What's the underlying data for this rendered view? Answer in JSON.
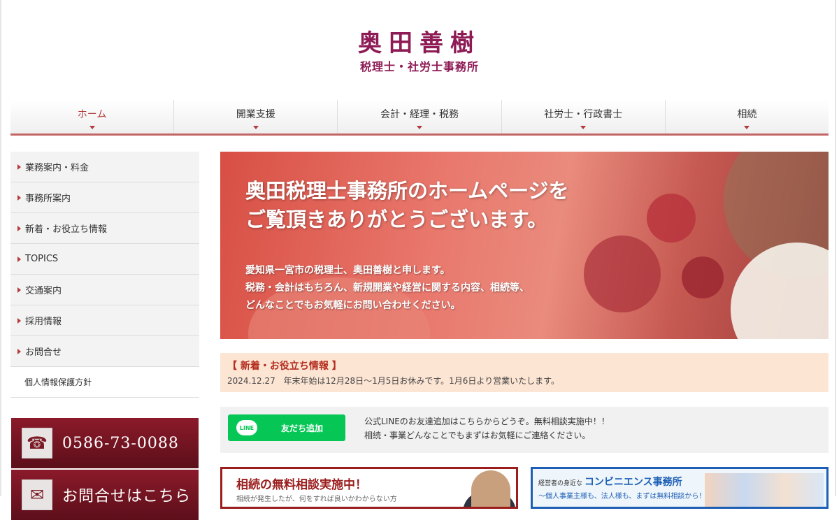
{
  "header": {
    "title": "奥田善樹",
    "subtitle": "税理士・社労士事務所"
  },
  "nav": {
    "items": [
      {
        "label": "ホーム"
      },
      {
        "label": "開業支援"
      },
      {
        "label": "会計・経理・税務"
      },
      {
        "label": "社労士・行政書士"
      },
      {
        "label": "相続"
      }
    ],
    "active": "ホーム"
  },
  "sidebar": {
    "items": [
      {
        "label": "業務案内・料金"
      },
      {
        "label": "事務所案内"
      },
      {
        "label": "新着・お役立ち情報"
      },
      {
        "label": "TOPICS"
      },
      {
        "label": "交通案内"
      },
      {
        "label": "採用情報"
      },
      {
        "label": "お問合せ"
      }
    ],
    "privacy": "個人情報保護方針",
    "phone": {
      "number": "0586-73-0088",
      "icon": "phone-icon"
    },
    "contact": {
      "label": "お問合せはこちら",
      "icon": "mail-icon"
    }
  },
  "hero": {
    "heading_line1": "奥田税理士事務所のホームページを",
    "heading_line2": "ご覧頂きありがとうございます。",
    "body_line1": "愛知県一宮市の税理士、奥田善樹と申します。",
    "body_line2": "税務・会計はもちろん、新規開業や経営に関する内容、相続等、",
    "body_line3": "どんなことでもお気軽にお問い合わせください。"
  },
  "news": {
    "title": "【 新着・お役立ち情報 】",
    "date": "2024.12.27",
    "text": "年末年始は12月28日～1月5日お休みです。1月6日より営業いたします。"
  },
  "line": {
    "badge": "LINE",
    "button_label": "友だち追加",
    "text_line1": "公式LINEのお友達追加はこちらからどうぞ。無料相談実施中！！",
    "text_line2": "相続・事業どんなことでもまずはお気軽にご連絡ください。"
  },
  "banners": {
    "inheritance": {
      "title": "相続の無料相談実施中！",
      "subtitle": "相続が発生したが、何をすれば良いかわからない方"
    },
    "convenience": {
      "prefix": "経営者の身近な",
      "title": "コンビニエンス事務所",
      "subtitle": "～個人事業主様も、法人様も、まずは無料相談から！～"
    }
  },
  "colors": {
    "brand": "#8e1b55",
    "accent": "#b43b3b",
    "line_green": "#06c755"
  }
}
